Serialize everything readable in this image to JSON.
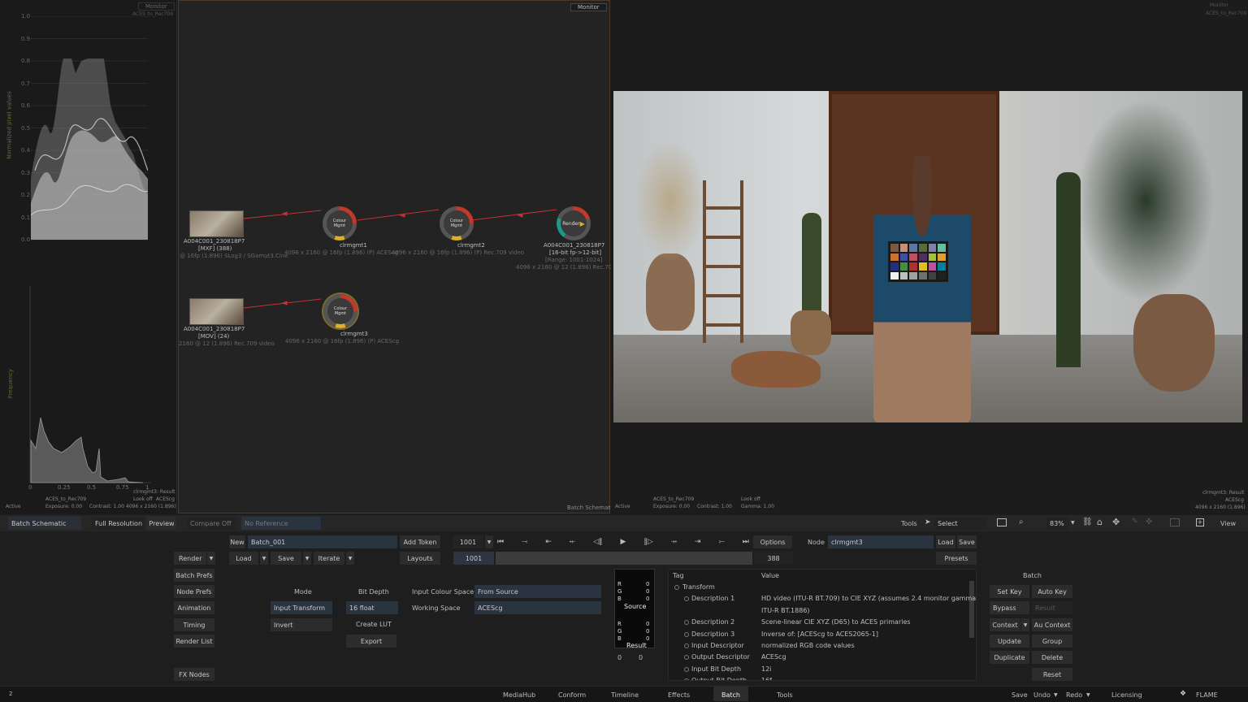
{
  "scopes": {
    "waveform_title": "Monitor",
    "waveform_sub": "ACES_to_Rec709",
    "waveform_ylabel": "Normalized pixel values",
    "waveform_ticks": [
      "1.0",
      "0.9",
      "0.8",
      "0.7",
      "0.6",
      "0.5",
      "0.4",
      "0.3",
      "0.2",
      "0.1",
      "0.0"
    ],
    "hist_ylabel": "Frequency",
    "hist_xticks": [
      "0",
      "0.25",
      "0.5",
      "0.75",
      "1"
    ],
    "info_left": "ACES_to_Rec709",
    "info_right1": "clrmgmt3: Result",
    "info_right2": "Look off",
    "info_right3": "ACEScg",
    "info_exposure": "Exposure: 0.00",
    "info_contrast": "Contrast: 1.00",
    "info_res": "4096 x 2160 (1.896)",
    "active": "Active"
  },
  "schematic": {
    "monitor_btn": "Monitor",
    "footer": "Batch Schematic",
    "clip1_name": "A004C001_230818P7",
    "clip1_fmt": "[MXF] (388)",
    "clip1_info": "@ 16fp (1.896) SLog3 / SGamut3.Cine",
    "node1_label": "Colour Mgmt",
    "node1_name": "clrmgmt1",
    "node1_info": "4096 x 2160 @ 16fp (1.896) (P) ACEScg",
    "node2_label": "Colour Mgmt",
    "node2_name": "clrmgmt2",
    "node2_info": "4096 x 2160 @ 16fp (1.896) (P) Rec.709 video",
    "render_label": "Render",
    "render_name": "A004C001_230818P7",
    "render_bits": "[16-bit fp->12-bit]",
    "render_range": "[Range: 1001-1024]",
    "render_info": "4096 x 2160 @ 12 (1.896) Rec.709",
    "clip2_name": "A004C001_230818P7",
    "clip2_fmt": "[MOV] (24)",
    "clip2_info": "2160 @ 12 (1.896) Rec.709 video",
    "node3_label": "Colour Mgmt",
    "node3_name": "clrmgmt3",
    "node3_info": "4096 x 2160 @ 16fp (1.896) (P) ACEScg"
  },
  "viewer": {
    "top_right_1": "Monitor",
    "top_right_2": "ACES_to_Rec709",
    "footer_active": "Active",
    "footer_left1": "ACES_to_Rec709",
    "footer_exposure": "Exposure: 0.00",
    "footer_contrast": "Contrast: 1.00",
    "footer_look": "Look off",
    "footer_gamma": "Gamma: 1.00",
    "footer_r1": "clrmgmt3: Result",
    "footer_r2": "ACEScg",
    "footer_r3": "4096 x 2160 (1.896)"
  },
  "toolbar": {
    "batch_schematic": "Batch Schematic",
    "full_resolution": "Full Resolution",
    "preview": "Preview",
    "compare_off": "Compare Off",
    "no_reference": "No Reference",
    "tools": "Tools",
    "select": "Select",
    "zoom": "83%",
    "view": "View"
  },
  "controls": {
    "render": "Render",
    "new": "New",
    "batch_name": "Batch_001",
    "add_token": "Add Token",
    "frame": "1001",
    "options": "Options",
    "node_label": "Node",
    "node_value": "clrmgmt3",
    "load": "Load",
    "save": "Save",
    "iterate": "Iterate",
    "layouts": "Layouts",
    "range_start": "1001",
    "range_end": "388",
    "presets": "Presets",
    "batch_prefs": "Batch Prefs",
    "node_prefs": "Node Prefs",
    "animation": "Animation",
    "timing": "Timing",
    "render_list": "Render List",
    "fx_nodes": "FX Nodes",
    "mode_hdr": "Mode",
    "mode_value": "Input Transform",
    "invert": "Invert",
    "bitdepth_hdr": "Bit Depth",
    "bitdepth_value": "16 float",
    "create_lut": "Create LUT",
    "export": "Export",
    "input_cs_label": "Input Colour Space",
    "input_cs_value": "From Source",
    "working_label": "Working Space",
    "working_value": "ACEScg",
    "source_label": "Source",
    "result_label": "Result",
    "rgb_letters": [
      "R",
      "G",
      "B"
    ],
    "rgb_zero": "0",
    "xy_x": "0",
    "xy_y": "0",
    "batch_hdr": "Batch",
    "set_key": "Set Key",
    "auto_key": "Auto Key",
    "bypass": "Bypass",
    "result": "Result",
    "context": "Context",
    "au_context": "Au Context",
    "update": "Update",
    "group": "Group",
    "duplicate": "Duplicate",
    "delete": "Delete",
    "reset": "Reset"
  },
  "tag_table": {
    "col_tag": "Tag",
    "col_value": "Value",
    "rows": [
      {
        "tag": "Transform",
        "value": ""
      },
      {
        "tag": "Description 1",
        "value": "HD video (ITU-R BT.709) to CIE XYZ (assumes 2.4 monitor gamma per"
      },
      {
        "tag": "",
        "value": "ITU-R BT.1886)"
      },
      {
        "tag": "Description 2",
        "value": "Scene-linear CIE XYZ (D65) to ACES primaries"
      },
      {
        "tag": "Description 3",
        "value": "Inverse of: [ACEScg to ACES2065-1]"
      },
      {
        "tag": "Input Descriptor",
        "value": "normalized RGB code values"
      },
      {
        "tag": "Output Descriptor",
        "value": "ACEScg"
      },
      {
        "tag": "Input Bit Depth",
        "value": "12i"
      },
      {
        "tag": "Output Bit Depth",
        "value": "16f"
      }
    ]
  },
  "bottom_bar": {
    "left_icon": "2",
    "tabs": [
      "MediaHub",
      "Conform",
      "Timeline",
      "Effects",
      "Batch",
      "Tools"
    ],
    "active_tab": "Batch",
    "save": "Save",
    "undo": "Undo",
    "redo": "Redo",
    "licensing": "Licensing",
    "brand": "FLAME"
  },
  "colors": {
    "accent_field": "#2a3340",
    "node_red": "#c0392b",
    "node_yellow": "#e0b020",
    "node_teal": "#1a9a8a",
    "link_red": "#c83232"
  }
}
